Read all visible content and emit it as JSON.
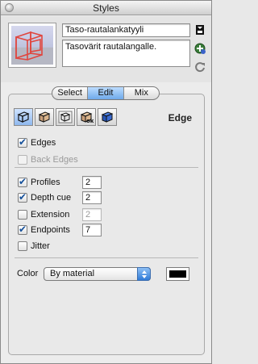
{
  "window": {
    "title": "Styles"
  },
  "style": {
    "name": "Taso-rautalankatyyli",
    "description": "Tasovärit rautalangalle."
  },
  "side_buttons": [
    "details-toggle-icon",
    "create-style-icon",
    "update-style-icon"
  ],
  "tabs": [
    {
      "label": "Select",
      "active": false
    },
    {
      "label": "Edit",
      "active": true
    },
    {
      "label": "Mix",
      "active": false
    }
  ],
  "category_icons": [
    "edge-settings-icon",
    "face-settings-icon",
    "background-settings-icon",
    "watermark-settings-icon",
    "modeling-settings-icon"
  ],
  "section": {
    "title": "Edge"
  },
  "edges": {
    "edges": {
      "label": "Edges",
      "checked": true
    },
    "back_edges": {
      "label": "Back Edges",
      "checked": false,
      "enabled": false
    },
    "profiles": {
      "label": "Profiles",
      "checked": true,
      "value": "2"
    },
    "depth_cue": {
      "label": "Depth cue",
      "checked": true,
      "value": "2"
    },
    "extension": {
      "label": "Extension",
      "checked": false,
      "value": "2",
      "enabled": false
    },
    "endpoints": {
      "label": "Endpoints",
      "checked": true,
      "value": "7"
    },
    "jitter": {
      "label": "Jitter",
      "checked": false
    }
  },
  "color": {
    "label": "Color",
    "selected": "By material",
    "swatch": "#000000"
  },
  "colors": {
    "accent": "#6ea9ea",
    "check": "#15509a"
  }
}
